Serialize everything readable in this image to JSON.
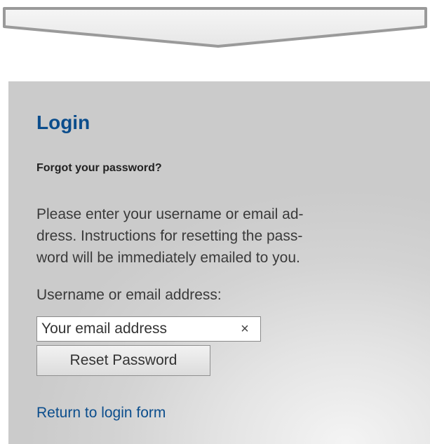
{
  "login": {
    "title": "Login",
    "subtitle": "Forgot your password?",
    "instructions": [
      "Please enter your username or email ad-",
      "dress. Instructions for resetting the pass-",
      "word will be immediately emailed to you."
    ],
    "field_label": "Username or email address:",
    "email_placeholder": "Your email address",
    "clear_symbol": "×",
    "reset_button_label": "Reset Password",
    "return_link_label": "Return to login form"
  },
  "colors": {
    "title": "#0b4d8c",
    "link": "#0b4d8c",
    "panel_background": "#d3d3d3"
  },
  "icons": {
    "banner": "chevron-arrow-banner-icon",
    "clear": "clear-icon"
  }
}
